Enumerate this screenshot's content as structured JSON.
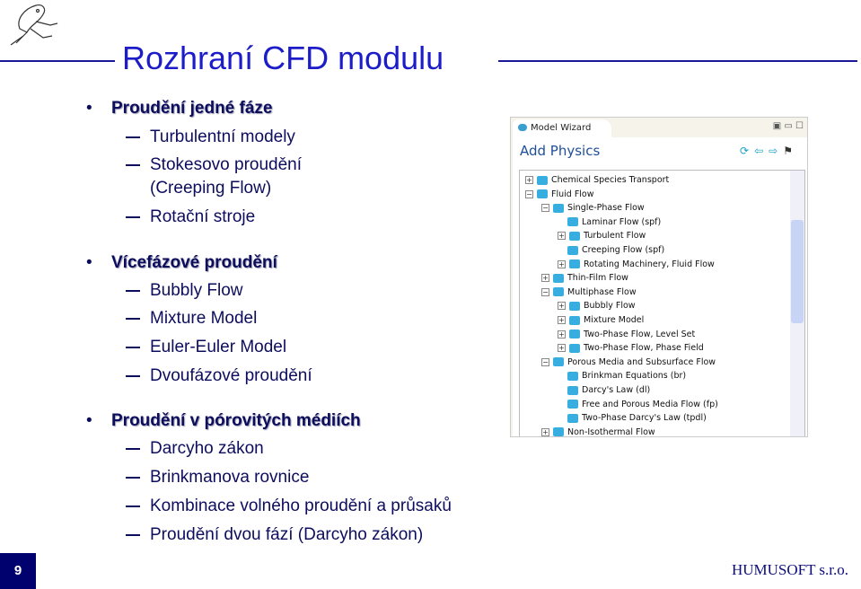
{
  "title": "Rozhraní CFD modulu",
  "page_number": "9",
  "brand": "HUMUSOFT s.r.o.",
  "colors": {
    "title": "#1c1cc8",
    "text": "#0d0d5e",
    "footer_box": "#00006e"
  },
  "logo": {
    "icon": "bird-sketch-logo"
  },
  "bullets": [
    {
      "label": "Proudění jedné fáze",
      "items": [
        "Turbulentní modely",
        "Stokesovo proudění",
        "(Creeping Flow)",
        "Rotační stroje"
      ]
    },
    {
      "label": "Vícefázové proudění",
      "items": [
        "Bubbly Flow",
        "Mixture Model",
        "Euler-Euler Model",
        "Dvoufázové proudění"
      ]
    },
    {
      "label": "Proudění v pórovitých médiích",
      "items": [
        "Darcyho zákon",
        "Brinkmanova rovnice",
        "Kombinace volného proudění a průsaků",
        "Proudění dvou fází (Darcyho zákon)"
      ]
    }
  ],
  "screenshot": {
    "tab": "Model Wizard",
    "heading": "Add Physics",
    "toolbar_icons": [
      "refresh-icon",
      "back-arrow-icon",
      "forward-arrow-icon",
      "finish-flag-icon"
    ],
    "tree": [
      {
        "label": "Chemical Species Transport",
        "level": 0,
        "exp": "+"
      },
      {
        "label": "Fluid Flow",
        "level": 0,
        "exp": "-"
      },
      {
        "label": "Single-Phase Flow",
        "level": 1,
        "exp": "-"
      },
      {
        "label": "Laminar Flow (spf)",
        "level": 2,
        "exp": ""
      },
      {
        "label": "Turbulent Flow",
        "level": 2,
        "exp": "+"
      },
      {
        "label": "Creeping Flow (spf)",
        "level": 2,
        "exp": ""
      },
      {
        "label": "Rotating Machinery, Fluid Flow",
        "level": 2,
        "exp": "+"
      },
      {
        "label": "Thin-Film Flow",
        "level": 1,
        "exp": "+"
      },
      {
        "label": "Multiphase Flow",
        "level": 1,
        "exp": "-"
      },
      {
        "label": "Bubbly Flow",
        "level": 2,
        "exp": "+"
      },
      {
        "label": "Mixture Model",
        "level": 2,
        "exp": "+"
      },
      {
        "label": "Two-Phase Flow, Level Set",
        "level": 2,
        "exp": "+"
      },
      {
        "label": "Two-Phase Flow, Phase Field",
        "level": 2,
        "exp": "+"
      },
      {
        "label": "Porous Media and Subsurface Flow",
        "level": 1,
        "exp": "-"
      },
      {
        "label": "Brinkman Equations (br)",
        "level": 2,
        "exp": ""
      },
      {
        "label": "Darcy's Law (dl)",
        "level": 2,
        "exp": ""
      },
      {
        "label": "Free and Porous Media Flow (fp)",
        "level": 2,
        "exp": ""
      },
      {
        "label": "Two-Phase Darcy's Law (tpdl)",
        "level": 2,
        "exp": ""
      },
      {
        "label": "Non-Isothermal Flow",
        "level": 1,
        "exp": "+"
      }
    ]
  }
}
